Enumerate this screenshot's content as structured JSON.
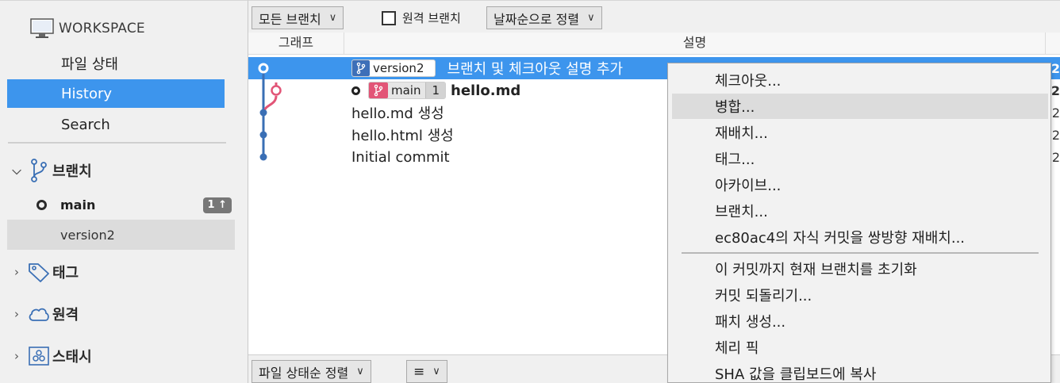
{
  "sidebar": {
    "workspace_label": "WORKSPACE",
    "workspace_items": [
      {
        "label": "파일 상태",
        "selected": false
      },
      {
        "label": "History",
        "selected": true
      },
      {
        "label": "Search",
        "selected": false
      }
    ],
    "branches_section": "브랜치",
    "branches": [
      {
        "name": "main",
        "current": true,
        "ahead": "1 ↑"
      },
      {
        "name": "version2",
        "current": false
      }
    ],
    "tags_section": "태그",
    "remotes_section": "원격",
    "stashes_section": "스태시"
  },
  "toolbar": {
    "branch_filter": "모든 브랜치",
    "remote_branches_label": "원격 브랜치",
    "remote_branches_checked": false,
    "sort_order": "날짜순으로 정렬"
  },
  "columns": {
    "graph": "그래프",
    "description": "설명"
  },
  "commits": [
    {
      "branch_label": "version2",
      "message": "브랜치 및 체크아웃 설명 추가",
      "selected": true,
      "right_text": "2"
    },
    {
      "branch_label": "main",
      "ahead_count": "1",
      "message": "hello.md",
      "bold": true,
      "right_text": "2"
    },
    {
      "message": "hello.md 생성",
      "right_text": "2"
    },
    {
      "message": "hello.html 생성",
      "right_text": "2"
    },
    {
      "message": "Initial commit",
      "right_text": "2"
    }
  ],
  "bottombar": {
    "file_sort": "파일 상태순 정렬",
    "view_mode_icon": "list-icon"
  },
  "context_menu": {
    "items": [
      {
        "label": "체크아웃..."
      },
      {
        "label": "병합...",
        "hover": true
      },
      {
        "label": "재배치..."
      },
      {
        "label": "태그..."
      },
      {
        "label": "아카이브..."
      },
      {
        "label": "브랜치..."
      },
      {
        "label": "ec80ac4의 자식 커밋을 쌍방향 재배치..."
      },
      {
        "label": "이 커밋까지 현재 브랜치를 초기화"
      },
      {
        "label": "커밋 되돌리기..."
      },
      {
        "label": "패치 생성..."
      },
      {
        "label": "체리 픽"
      },
      {
        "label": "SHA 값을 클립보드에 복사"
      }
    ]
  },
  "colors": {
    "selection": "#3d95ed",
    "graph_blue": "#3a6fb5",
    "graph_pink": "#e25577"
  }
}
